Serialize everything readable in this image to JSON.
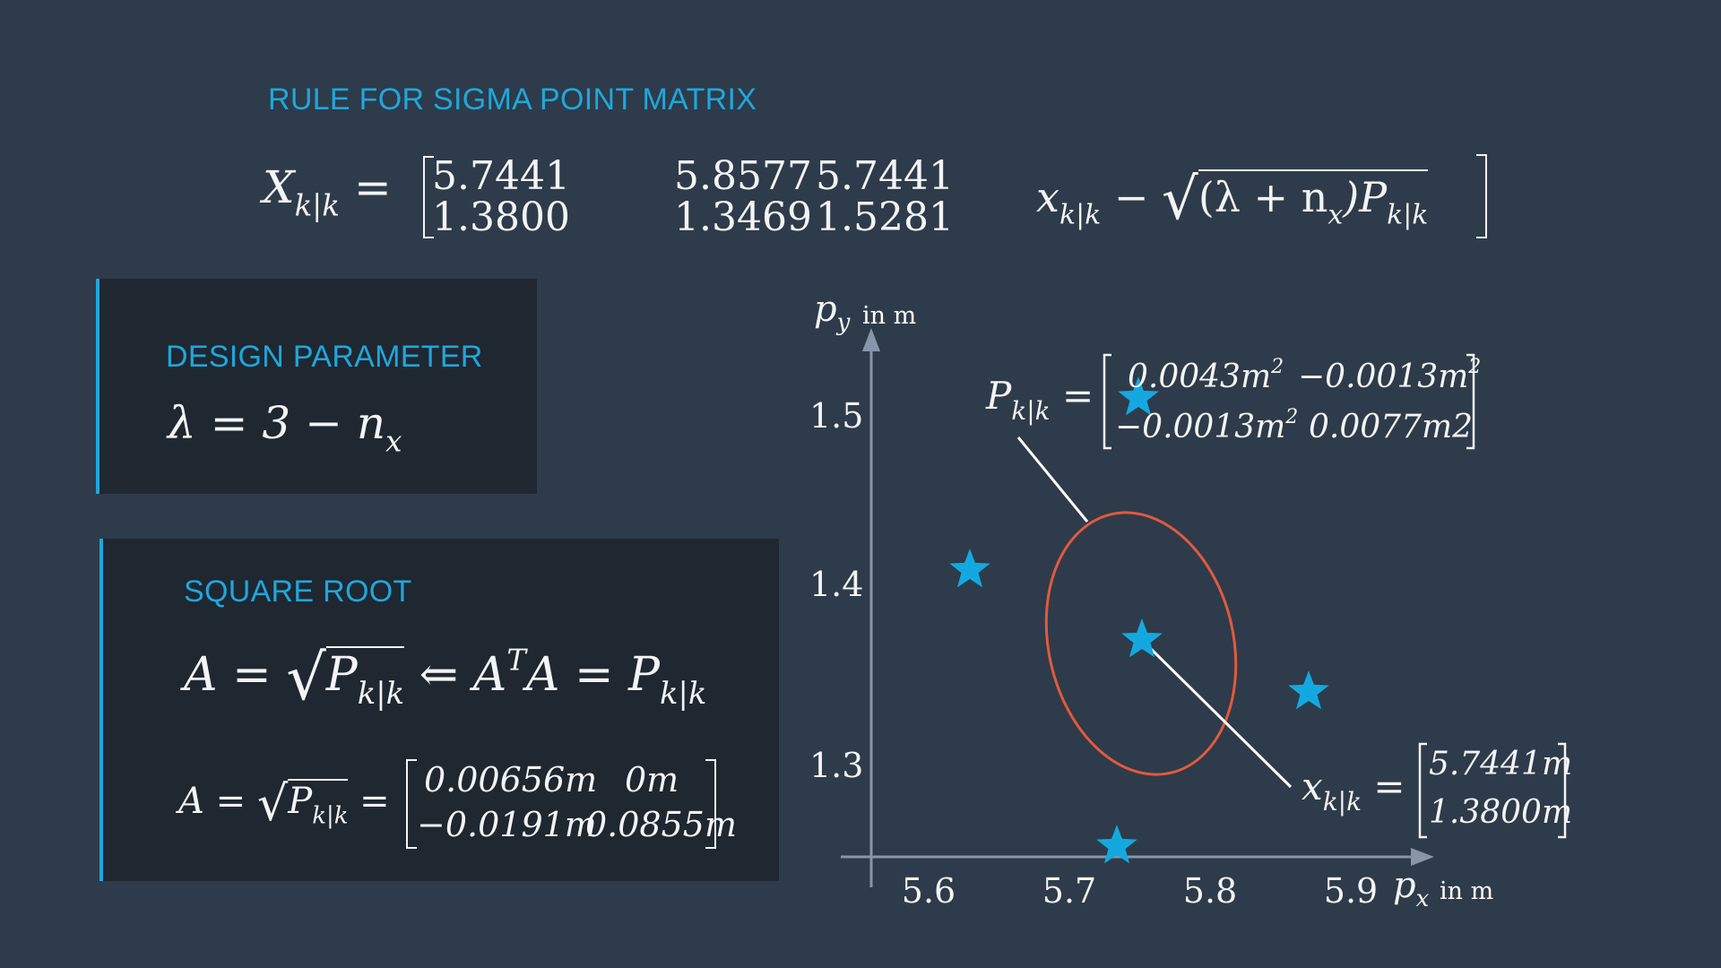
{
  "header": {
    "title": "RULE FOR SIGMA POINT MATRIX",
    "lhs": "X",
    "lhs_sub": "k|k",
    "col1": [
      "5.7441",
      "1.3800"
    ],
    "col2": [
      "5.8577",
      "1.3469"
    ],
    "col3": [
      "5.7441",
      "1.5281"
    ],
    "tail_x": "x",
    "tail_sub": "k|k",
    "tail_rest": " − ",
    "tail_sqrt": "(λ + n",
    "tail_sqrt_sub": "x",
    "tail_sqrt_end": ")P",
    "tail_sqrt_end_sub": "k|k"
  },
  "design": {
    "title": "DESIGN PARAMETER",
    "formula": "λ = 3 − n",
    "formula_sub": "x"
  },
  "sqrt_panel": {
    "title": "SQUARE ROOT",
    "eq1_a": "A = ",
    "eq1_p": "P",
    "eq1_p_sub": "k|k",
    "eq1_mid": " ⇐ A",
    "eq1_sup": "T",
    "eq1_end": "A = P",
    "eq1_end_sub": "k|k",
    "eq2_a": "A = ",
    "eq2_p": "P",
    "eq2_p_sub": "k|k",
    "eq2_eq": " = ",
    "matrix": [
      [
        "0.00656m",
        "0m"
      ],
      [
        "−0.0191m",
        "0.0855m"
      ]
    ]
  },
  "plot": {
    "y_axis_symbol": "p",
    "y_axis_sub": "y",
    "y_axis_unit": "in m",
    "x_axis_symbol": "p",
    "x_axis_sub": "x",
    "x_axis_unit": "in m",
    "x_ticks": [
      "5.6",
      "5.7",
      "5.8",
      "5.9"
    ],
    "y_ticks": [
      "1.5",
      "1.4",
      "1.3"
    ],
    "cov_label": "P",
    "cov_label_sub": "k|k",
    "cov_eq": " = ",
    "cov_matrix": [
      [
        "0.0043m",
        "−0.0013m"
      ],
      [
        "−0.0013m",
        "0.0077m2"
      ]
    ],
    "cov_sup": "2",
    "mean_label": "x",
    "mean_label_sub": "k|k",
    "mean_eq": " = ",
    "mean_vec": [
      "5.7441m",
      "1.3800m"
    ],
    "star_color": "#13a9e0",
    "ellipse_color": "#e05a3e"
  }
}
